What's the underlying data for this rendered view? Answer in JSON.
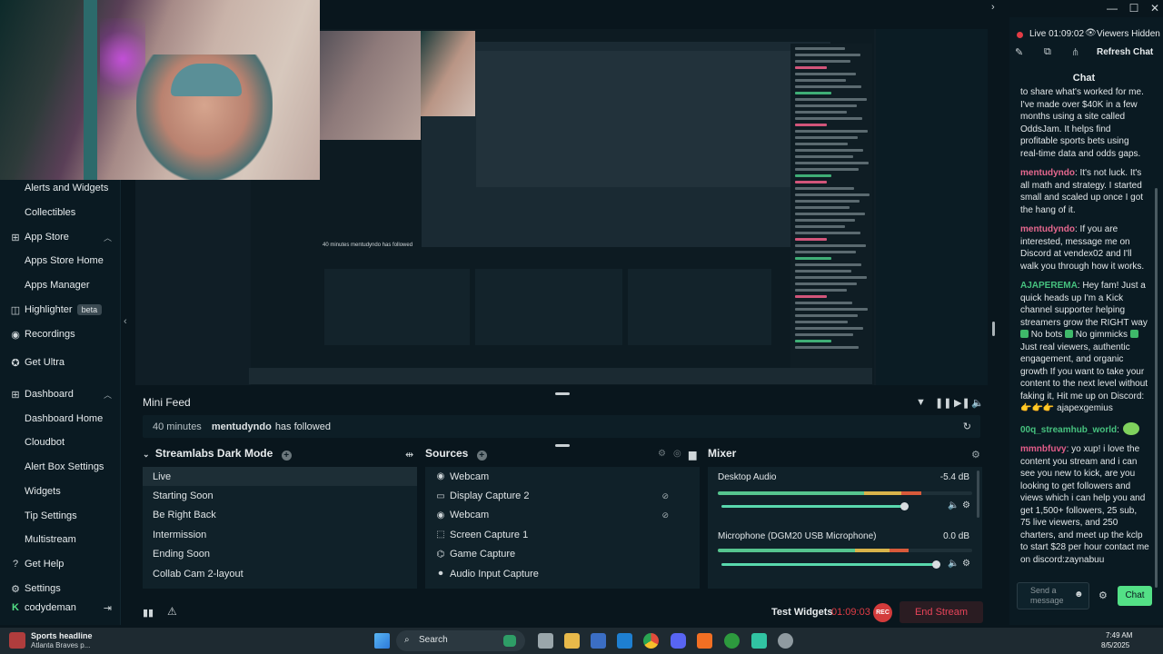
{
  "window": {
    "expand_icon": "chevron-right-icon",
    "minimize": "—",
    "maximize": "☐",
    "close": "✕"
  },
  "sidebar": {
    "items": [
      {
        "label": "Alerts and Widgets",
        "type": "sub"
      },
      {
        "label": "Collectibles",
        "type": "sub"
      },
      {
        "label": "App Store",
        "type": "top",
        "icon": "apps-icon",
        "chevron": "up"
      },
      {
        "label": "Apps Store Home",
        "type": "sub"
      },
      {
        "label": "Apps Manager",
        "type": "sub"
      },
      {
        "label": "Highlighter",
        "type": "top",
        "icon": "highlighter-icon",
        "badge": "beta"
      },
      {
        "label": "Recordings",
        "type": "top",
        "icon": "recordings-icon"
      },
      {
        "label": "Get Ultra",
        "type": "top",
        "icon": "ultra-icon"
      },
      {
        "label": "Dashboard",
        "type": "top",
        "icon": "dashboard-icon",
        "chevron": "up"
      },
      {
        "label": "Dashboard Home",
        "type": "sub"
      },
      {
        "label": "Cloudbot",
        "type": "sub"
      },
      {
        "label": "Alert Box Settings",
        "type": "sub"
      },
      {
        "label": "Widgets",
        "type": "sub"
      },
      {
        "label": "Tip Settings",
        "type": "sub"
      },
      {
        "label": "Multistream",
        "type": "sub"
      },
      {
        "label": "Get Help",
        "type": "top",
        "icon": "help-icon"
      },
      {
        "label": "Settings",
        "type": "top",
        "icon": "gear-icon"
      }
    ],
    "user": {
      "name": "codydeman",
      "logout_icon": "logout-icon"
    }
  },
  "minifeed": {
    "title": "Mini Feed",
    "event": {
      "time": "40 minutes",
      "user": "mentudyndo",
      "action": "has followed"
    }
  },
  "scenes": {
    "title": "Streamlabs Dark Mode",
    "items": [
      "Live",
      "Starting Soon",
      "Be Right Back",
      "Intermission",
      "Ending Soon",
      "Collab Cam 2-layout"
    ],
    "active_index": 0
  },
  "sources": {
    "title": "Sources",
    "items": [
      {
        "label": "Webcam",
        "icon": "webcam-icon",
        "hidden": false
      },
      {
        "label": "Display Capture 2",
        "icon": "monitor-icon",
        "hidden": true
      },
      {
        "label": "Webcam",
        "icon": "webcam-icon",
        "hidden": true
      },
      {
        "label": "Screen Capture 1",
        "icon": "screen-capture-icon",
        "hidden": false
      },
      {
        "label": "Game Capture",
        "icon": "gamepad-icon",
        "hidden": false
      },
      {
        "label": "Audio Input Capture",
        "icon": "microphone-icon",
        "hidden": false
      }
    ]
  },
  "mixer": {
    "title": "Mixer",
    "channels": [
      {
        "name": "Desktop Audio",
        "db": "-5.4 dB",
        "level": 0.8,
        "volume": 0.85
      },
      {
        "name": "Microphone (DGM20 USB Microphone)",
        "db": "0.0 dB",
        "level": 0.75,
        "volume": 1.0
      }
    ]
  },
  "statusbar": {
    "test_widgets": "Test Widgets",
    "timer": "01:09:03",
    "rec": "REC",
    "end_stream": "End Stream"
  },
  "chat": {
    "live": "Live 01:09:02",
    "viewers": "Viewers Hidden",
    "refresh": "Refresh Chat",
    "title": "Chat",
    "input_placeholder": "Send a message",
    "send_label": "Chat",
    "messages": [
      {
        "user": "",
        "text": "to share what's worked for me. I've made over $40K in a few months using a site called OddsJam. It helps find profitable sports bets using real-time data and odds gaps."
      },
      {
        "user": "mentudyndo",
        "text": ": It's not luck. It's all math and strategy. I started small and scaled up once I got the hang of it."
      },
      {
        "user": "mentudyndo",
        "text": ": If you are interested, message me on Discord at vendex02 and I'll walk you through how it works."
      },
      {
        "user": "AJAPEREMA",
        "text": ": Hey fam! Just a quick heads up I'm a Kick channel supporter helping streamers grow the RIGHT way",
        "extra": [
          " No bots ",
          " No gimmicks ",
          " Just real viewers, authentic engagement, and organic growth If you want to take your content to the next level without faking it, Hit me up on Discord: 👉👉👉 ajapexgemius"
        ]
      },
      {
        "user": "00q_streamhub_world",
        "text": ":"
      },
      {
        "user": "mmnbfuvy",
        "text": ": yo xup! i love the content you stream and i can see you new to kick, are you looking to get followers and views which i can help you and get 1,500+ followers, 25 sub, 75 live viewers, and 250 charters, and meet up the kclp to start $28 per hour contact me on discord:zaynabuu"
      }
    ]
  },
  "taskbar": {
    "news_title": "Sports headline",
    "news_sub": "Atlanta Braves p...",
    "search": "Search",
    "time": "7:49 AM",
    "date": "8/5/2025"
  },
  "preview": {
    "feed": "40 minutes   mentudyndo   has followed"
  },
  "colors": {
    "accent_green": "#53e086",
    "end_stream": "#e0374c",
    "rec_red": "#d33b3b",
    "chat_user_pink": "#e6688f",
    "chat_user_green": "#46c27f"
  }
}
